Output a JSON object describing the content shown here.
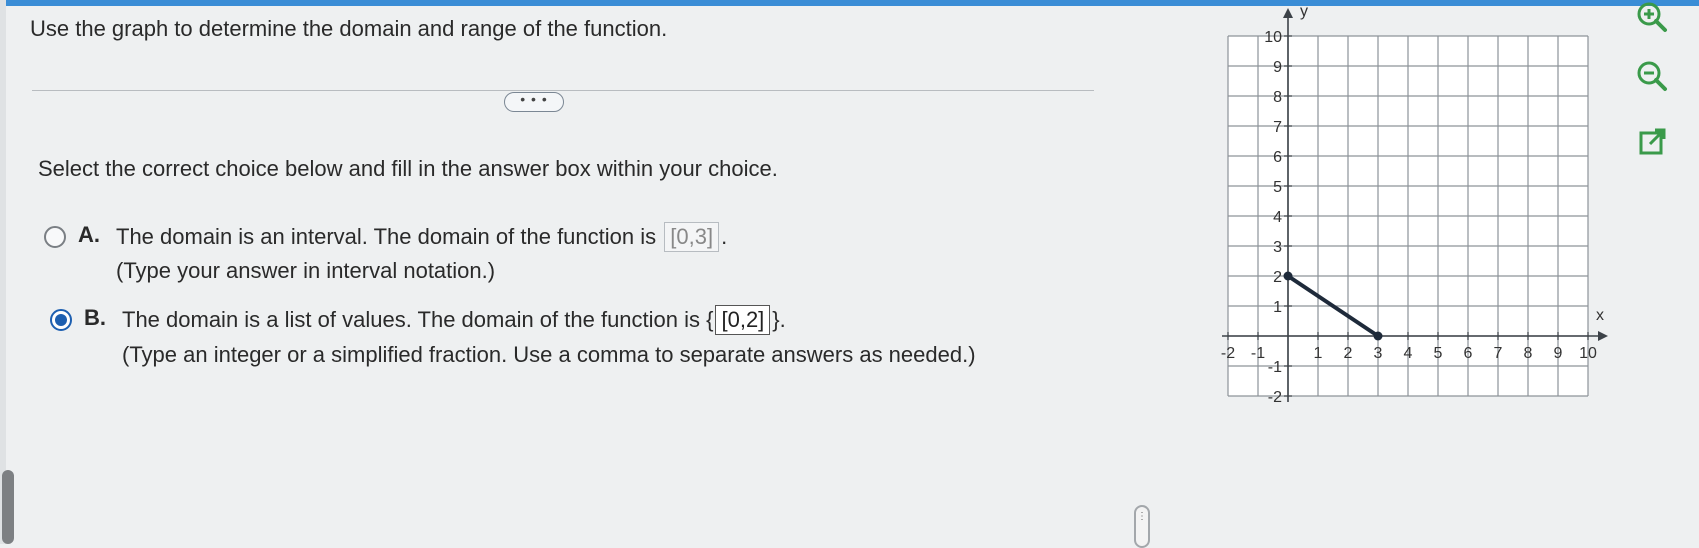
{
  "question": "Use the graph to determine the domain and range of the function.",
  "more_button_label": "• • •",
  "instruction": "Select the correct choice below and fill in the answer box within your choice.",
  "options": [
    {
      "letter": "A.",
      "text_before": "The domain is an interval. The domain of the function is",
      "answer": "[0,3]",
      "text_after": ".",
      "hint": "(Type your answer in interval notation.)",
      "selected": false
    },
    {
      "letter": "B.",
      "text_before": "The domain is a list of values. The domain of the function is {",
      "answer": "[0,2]",
      "text_after": "}.",
      "hint": "(Type an integer or a simplified fraction. Use a comma to separate answers as needed.)",
      "selected": true
    }
  ],
  "scroll_handle_label": "⋮",
  "chart_data": {
    "type": "line",
    "xlabel": "x",
    "ylabel": "y",
    "xlim": [
      -2,
      10
    ],
    "ylim": [
      -2,
      10
    ],
    "x_ticks": [
      "-2",
      "-1",
      "1",
      "2",
      "3",
      "4",
      "5",
      "6",
      "7",
      "8",
      "9",
      "10"
    ],
    "y_ticks": [
      "10",
      "9",
      "8",
      "7",
      "6",
      "5",
      "4",
      "3",
      "2",
      "1",
      "-1",
      "-2"
    ],
    "grid": true,
    "series": [
      {
        "x": [
          0,
          3
        ],
        "y": [
          2,
          0
        ],
        "closed_endpoints": true,
        "color": "#1e2a3a"
      }
    ]
  },
  "tools": [
    "zoom-in-icon",
    "zoom-out-icon",
    "open-external-icon"
  ],
  "colors": {
    "accent": "#1d5fb0",
    "top_bar": "#3a8dd6",
    "tool_green": "#3a9a4a"
  }
}
